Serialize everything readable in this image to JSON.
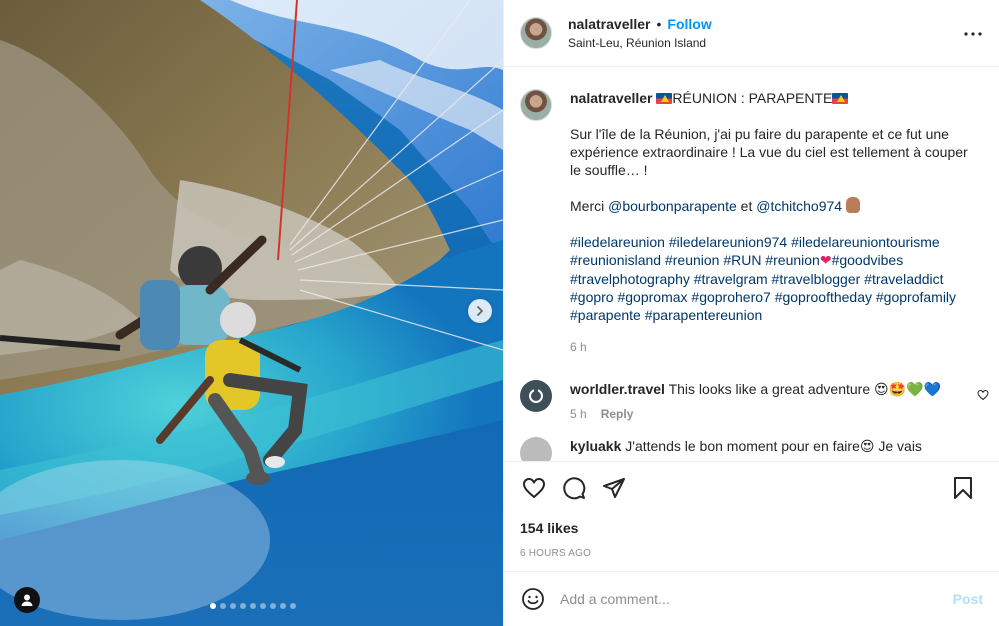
{
  "header": {
    "username": "nalatraveller",
    "separator": "•",
    "follow_label": "Follow",
    "location": "Saint-Leu, Réunion Island",
    "more_icon": "more-horizontal-icon"
  },
  "caption": {
    "username": "nalatraveller",
    "title": "RÉUNION : PARAPENTE",
    "paragraph1": "Sur l'île de la Réunion, j'ai pu faire du parapente et ce fut une expérience extraordinaire ! La vue du ciel est tellement à couper le souffle… !",
    "thanks_prefix": "Merci",
    "mention1": "@bourbonparapente",
    "thanks_and": "et",
    "mention2": "@tchitcho974",
    "hashtags_line1": "#iledelareunion #iledelareunion974 #iledelareuniontourisme",
    "hashtags_line2a": "#reunionisland #reunion #RUN #reunion",
    "hashtags_line2b": "#goodvibes",
    "hashtags_line3": "#travelphotography #travelgram #travelblogger #traveladdict",
    "hashtags_line4": "#gopro #gopromax #goprohero7 #goprooftheday #goprofamily",
    "hashtags_line5": "#parapente #parapentereunion",
    "time": "6 h"
  },
  "comments": [
    {
      "username": "worldler.travel",
      "text": "This looks like a great adventure",
      "emojis": "😍🤩💚💙",
      "time": "5 h",
      "reply_label": "Reply"
    },
    {
      "username": "kyluakk",
      "text": "J'attends le bon moment pour en faire",
      "emojis": "😍",
      "suffix": "Je vais"
    }
  ],
  "actions": {
    "likes": "154 likes",
    "time_ago": "6 HOURS AGO"
  },
  "add_comment": {
    "placeholder": "Add a comment...",
    "post_label": "Post"
  },
  "carousel": {
    "slides": 9,
    "active_index": 0
  },
  "colors": {
    "accent": "#0095f6",
    "post_disabled": "#b2dffc",
    "hashtag": "#00376b",
    "muted": "#8e8e8e"
  }
}
